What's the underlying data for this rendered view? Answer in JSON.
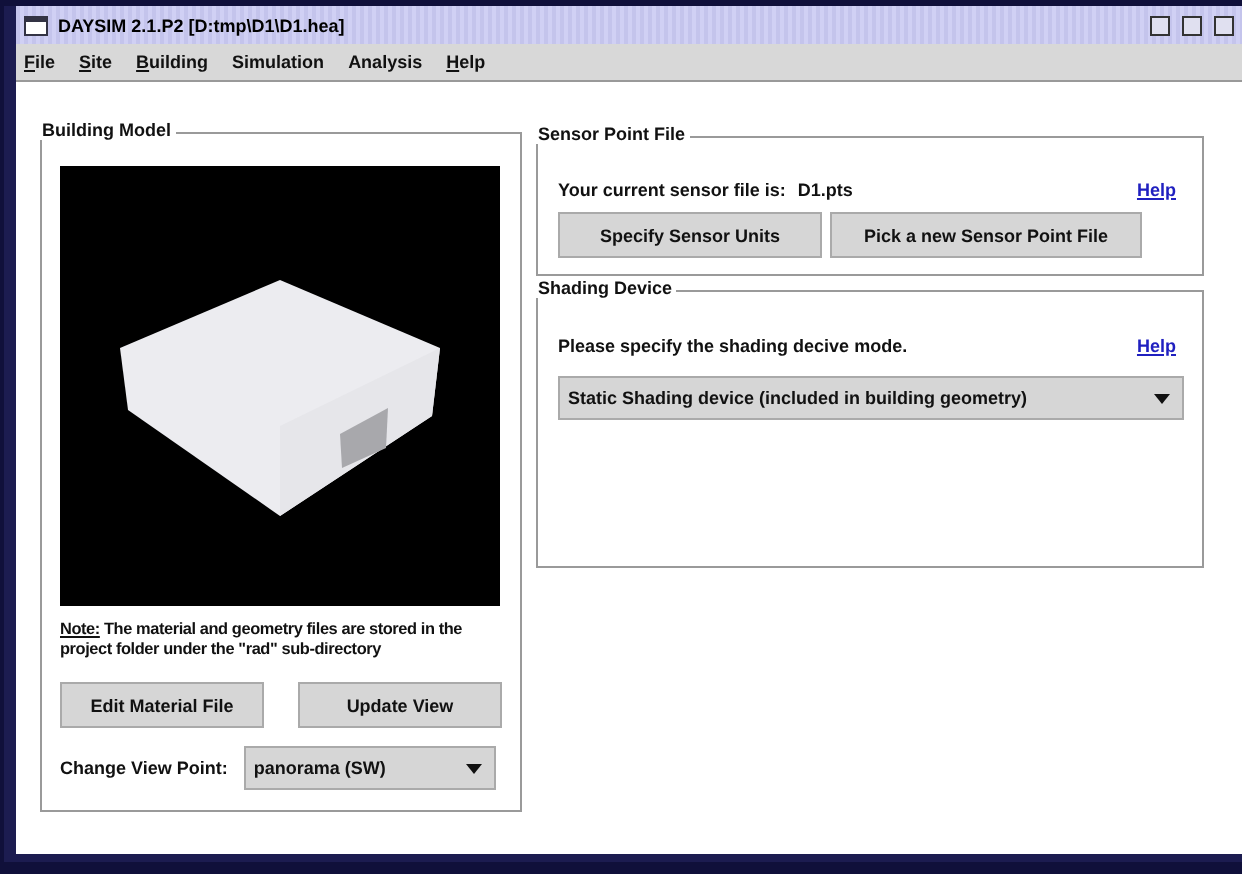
{
  "window": {
    "title": "DAYSIM 2.1.P2 [D:tmp\\D1\\D1.hea]"
  },
  "menu": [
    {
      "label": "File",
      "mnemonic": true
    },
    {
      "label": "Site",
      "mnemonic": true
    },
    {
      "label": "Building",
      "mnemonic": true
    },
    {
      "label": "Simulation",
      "mnemonic": false
    },
    {
      "label": "Analysis",
      "mnemonic": false
    },
    {
      "label": "Help",
      "mnemonic": true
    }
  ],
  "building_model": {
    "title": "Building Model",
    "note_label": "Note:",
    "note": "The material and geometry files are stored in the project folder under the \"rad\" sub-directory",
    "buttons": [
      "Edit Material File",
      "Update View"
    ],
    "view_label": "Change View Point:",
    "view_value": "panorama (SW)"
  },
  "sensor_point_file": {
    "title": "Sensor Point File",
    "text": "Your current sensor file is:",
    "file": "D1.pts",
    "help": "Help",
    "buttons": [
      "Specify Sensor Units",
      "Pick a new Sensor Point File"
    ]
  },
  "shading_device": {
    "title": "Shading Device",
    "text": "Please specify the shading decive mode.",
    "help": "Help",
    "mode": "Static Shading device (included in building geometry)"
  }
}
